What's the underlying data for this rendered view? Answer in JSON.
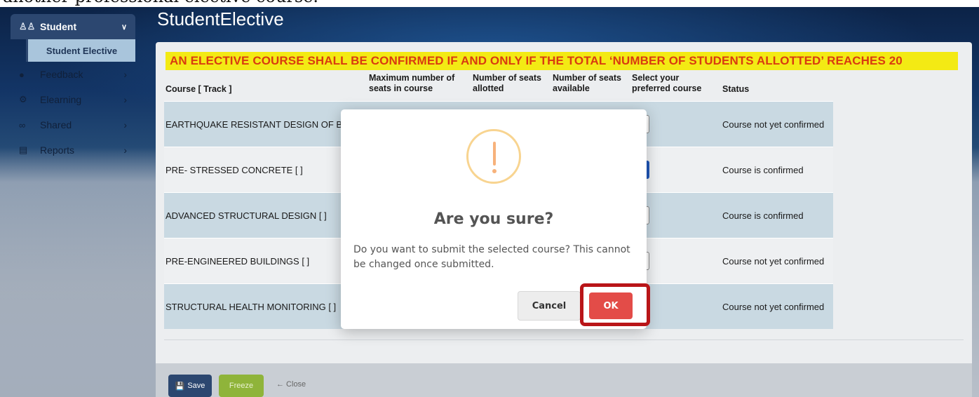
{
  "caption": {
    "text": "another professional elective course."
  },
  "sidebar": {
    "section": {
      "label": "Student",
      "icon": "users-icon"
    },
    "subitem": {
      "label": "Student Elective"
    },
    "items": [
      {
        "label": "Feedback",
        "icon": "user-icon"
      },
      {
        "label": "Elearning",
        "icon": "gears-icon"
      },
      {
        "label": "Shared",
        "icon": "share-icon"
      },
      {
        "label": "Reports",
        "icon": "printer-icon"
      }
    ]
  },
  "page": {
    "title": "StudentElective"
  },
  "banner": {
    "text": "AN ELECTIVE COURSE SHALL BE CONFIRMED IF AND ONLY IF THE TOTAL ‘NUMBER OF STUDENTS ALLOTTED’ REACHES 20"
  },
  "table": {
    "headers": {
      "course": "Course [ Track ]",
      "max_seats": "Maximum number of seats in course",
      "allotted": "Number of seats allotted",
      "available": "Number of seats available",
      "select": "Select your preferred course",
      "status": "Status"
    },
    "rows": [
      {
        "course": "EARTHQUAKE RESISTANT DESIGN OF BUILDI",
        "status": "Course not yet confirmed"
      },
      {
        "course": "PRE- STRESSED CONCRETE [ ]",
        "status": "Course is confirmed"
      },
      {
        "course": "ADVANCED STRUCTURAL DESIGN [ ]",
        "status": "Course is confirmed"
      },
      {
        "course": "PRE-ENGINEERED BUILDINGS [ ]",
        "status": "Course not yet confirmed"
      },
      {
        "course": "STRUCTURAL HEALTH MONITORING [ ]",
        "status": "Course not yet confirmed"
      }
    ]
  },
  "footer": {
    "save": "Save",
    "freeze": "Freeze",
    "close": "← Close"
  },
  "modal": {
    "title": "Are you sure?",
    "text": "Do you want to submit the selected course? This cannot be changed once submitted.",
    "cancel": "Cancel",
    "ok": "OK"
  },
  "colors": {
    "banner_bg": "#f3ea14",
    "banner_text": "#d93b10",
    "ok": "#e34c48",
    "highlight": "#b91518",
    "primary": "#2c4770"
  }
}
